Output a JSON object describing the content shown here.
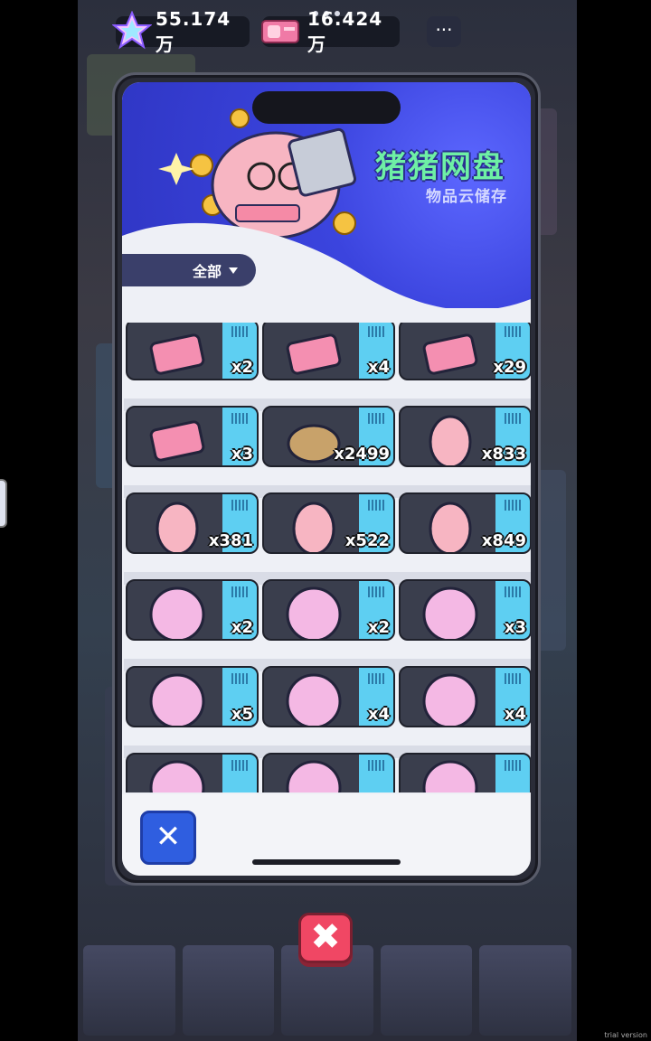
{
  "currency": {
    "gems": "55.174万",
    "tickets": "16.424万",
    "menu": "···"
  },
  "netdisk": {
    "title": "猪猪网盘",
    "subtitle": "物品云储存",
    "filter_label": "全部"
  },
  "items": [
    {
      "icon": "ticket-ou-pink-icon",
      "qty": "x2"
    },
    {
      "icon": "ticket-gan-blue-icon",
      "qty": "x4"
    },
    {
      "icon": "ticket-xiaofei-purple-icon",
      "qty": "x29"
    },
    {
      "icon": "ticket-xiaoou-pink-icon",
      "qty": "x3"
    },
    {
      "icon": "bread-roll-icon",
      "qty": "x2499"
    },
    {
      "icon": "pig-purple-bow-icon",
      "qty": "x833"
    },
    {
      "icon": "pig-blue-scarf-icon",
      "qty": "x381"
    },
    {
      "icon": "pig-yellow-hat-icon",
      "qty": "x522"
    },
    {
      "icon": "pig-pink-ribbon-icon",
      "qty": "x849"
    },
    {
      "icon": "avatar-silver-hair-icon",
      "qty": "x2"
    },
    {
      "icon": "avatar-dark-hair-icon",
      "qty": "x2"
    },
    {
      "icon": "avatar-blue-hair-icon",
      "qty": "x3"
    },
    {
      "icon": "avatar-lilac-hair-icon",
      "qty": "x5"
    },
    {
      "icon": "avatar-captain-hat-icon",
      "qty": "x4"
    },
    {
      "icon": "avatar-cyan-hair-icon",
      "qty": "x4"
    },
    {
      "icon": "avatar-blonde-hair-icon",
      "qty": ""
    },
    {
      "icon": "avatar-pink-hair-icon",
      "qty": ""
    },
    {
      "icon": "avatar-black-hair-icon",
      "qty": ""
    }
  ],
  "buttons": {
    "close_inner": "✕",
    "close_outer": "✖"
  },
  "watermark": "trial version",
  "colors": {
    "banner_blue": "#3b44de",
    "title_green": "#6ef0a5",
    "stripe_cyan": "#5ecff2",
    "close_red": "#f04764",
    "close_blue": "#2f5ee0"
  }
}
